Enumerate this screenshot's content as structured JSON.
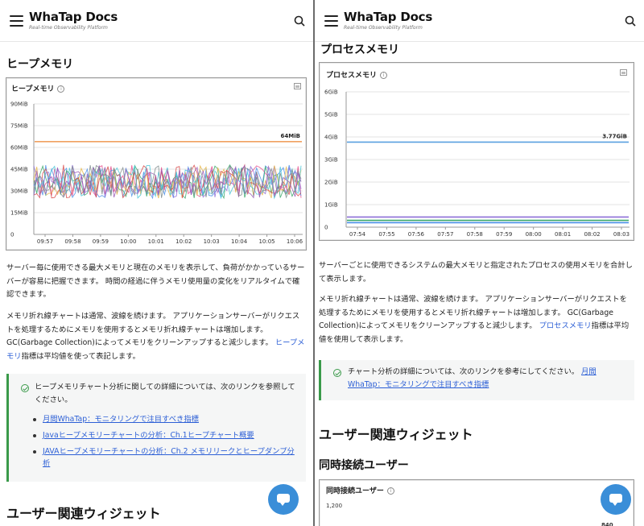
{
  "header": {
    "logo_title": "WhaTap Docs",
    "logo_subtitle": "Real-time Observability Platform"
  },
  "left": {
    "section_title": "ヒープメモリ",
    "chart_title": "ヒープメモリ",
    "para1": "サーバー毎に使用できる最大メモリと現在のメモリを表示して、負荷がかかっているサーバーが容易に把握できます。 時間の経過に伴うメモリ使用量の変化をリアルタイムで確認できます。",
    "para2_a": "メモリ折れ線チャートは通常、波線を続けます。 アプリケーションサーバーがリクエストを処理するためにメモリを使用するとメモリ折れ線チャートは増加します。 GC(Garbage Collection)によってメモリをクリーンアップすると減少します。 ",
    "para2_link": "ヒープメモリ",
    "para2_b": "指標は平均値を使って表記します。",
    "note_text": "ヒープメモリチャート分析に関しての詳細については、次のリンクを参照してください。",
    "note_links": [
      "月間WhaTap：モニタリングで注目すべき指標",
      "Javaヒープメモリーチャートの分析：Ch.1ヒープチャート概要",
      "JAVAヒープメモリーチャートの分析：Ch.2 メモリリークとヒープダンプ分析"
    ],
    "next_section": "ユーザー関連ウィジェット"
  },
  "right": {
    "section_title_partial": "プロセスメモリ",
    "chart_title": "プロセスメモリ",
    "para1": "サーバーごとに使用できるシステムの最大メモリと指定されたプロセスの使用メモリを合計して表示します。",
    "para2_a": "メモリ折れ線チャートは通常、波線を続けます。 アプリケーションサーバーがリクエストを処理するためにメモリを使用するとメモリ折れ線チャートは増加します。 GC(Garbage Collection)によってメモリをクリーンアップすると減少します。 ",
    "para2_link": "プロセスメモリ",
    "para2_b": "指標は平均値を使用して表示します。",
    "note_text_a": "チャート分析の詳細については、次のリンクを参考にしてください。 ",
    "note_link": "月間WhaTap：モニタリングで注目すべき指標",
    "section_h1": "ユーザー関連ウィジェット",
    "section_h2": "同時接続ユーザー",
    "chart3_title": "同時接続ユーザー",
    "chart3_ytick": "1,200",
    "chart3_partial_label": "840"
  },
  "chart_data": [
    {
      "type": "line",
      "title": "ヒープメモリ",
      "x": [
        "09:57",
        "09:58",
        "09:59",
        "10:00",
        "10:01",
        "10:02",
        "10:03",
        "10:04",
        "10:05",
        "10:06"
      ],
      "yticks": [
        "0",
        "15MiB",
        "30MiB",
        "45MiB",
        "60MiB",
        "75MiB",
        "90MiB"
      ],
      "ylim": [
        0,
        90
      ],
      "series": [
        {
          "values": [
            64,
            64,
            64,
            64,
            64,
            64,
            64,
            64,
            64,
            64
          ],
          "color": "#f0a060"
        }
      ],
      "noisy_band": {
        "min": 25,
        "max": 48,
        "series_count": 9,
        "colors": [
          "#e74c8c",
          "#4a8fe7",
          "#8e6fd8",
          "#3aa86b",
          "#e7b84a",
          "#d84a4a",
          "#4ac7d8",
          "#9b59b6",
          "#7f8c8d"
        ]
      },
      "annotations": [
        "64MiB"
      ],
      "grid": true
    },
    {
      "type": "line",
      "title": "プロセスメモリ",
      "x": [
        "07:54",
        "07:55",
        "07:56",
        "07:57",
        "07:58",
        "07:59",
        "08:00",
        "08:01",
        "08:02",
        "08:03"
      ],
      "yticks": [
        "0",
        "1GiB",
        "2GiB",
        "3GiB",
        "4GiB",
        "5GiB",
        "6GiB"
      ],
      "ylim": [
        0,
        6
      ],
      "series": [
        {
          "values": [
            3.77,
            3.77,
            3.77,
            3.77,
            3.77,
            3.77,
            3.77,
            3.77,
            3.77,
            3.77
          ],
          "color": "#5aa0e0"
        },
        {
          "values": [
            0.45,
            0.45,
            0.45,
            0.45,
            0.45,
            0.45,
            0.45,
            0.45,
            0.45,
            0.45
          ],
          "color": "#8e6fd8"
        },
        {
          "values": [
            0.3,
            0.3,
            0.3,
            0.3,
            0.3,
            0.3,
            0.3,
            0.3,
            0.3,
            0.3
          ],
          "color": "#3aa86b"
        },
        {
          "values": [
            0.2,
            0.2,
            0.2,
            0.2,
            0.2,
            0.2,
            0.2,
            0.2,
            0.2,
            0.2
          ],
          "color": "#4a8fe7"
        }
      ],
      "annotations": [
        "3.77GiB"
      ],
      "grid": true
    }
  ]
}
